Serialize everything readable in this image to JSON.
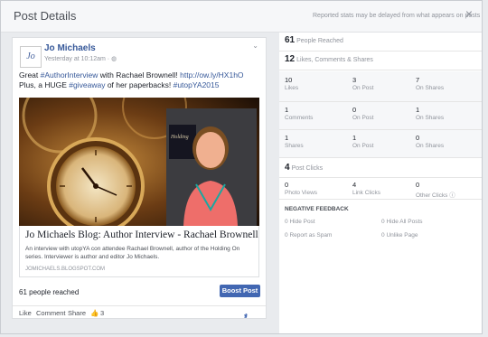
{
  "dialog": {
    "title": "Post Details",
    "notice": "Reported stats may be delayed from what appears on posts",
    "close": "×"
  },
  "post": {
    "avatar": "Jo",
    "author": "Jo Michaels",
    "time": "Yesterday at 10:12am · ",
    "text_a": "Great ",
    "tag1": "#AuthorInterview",
    "text_b": " with Rachael Brownell! ",
    "link": "http://ow.ly/HX1hO",
    "text_c": " Plus, a HUGE ",
    "tag2": "#giveaway",
    "text_d": " of her paperbacks! ",
    "tag3": "#utopYA2015",
    "link_title": "Jo Michaels Blog: Author Interview - Rachael Brownell",
    "link_desc": "An interview with utopYA con attendee Rachael Brownell, author of the Holding On series. Interviewer is author and editor Jo Michaels.",
    "link_domain": "JOMICHAELS.BLOGSPOT.COM",
    "reached": "61 people reached",
    "boost": "Boost Post",
    "like": "Like",
    "comment": "Comment",
    "share": "Share",
    "likes_count": "3",
    "poster_icon": "J"
  },
  "stats": {
    "reached_num": "61",
    "reached_label": "People Reached",
    "lcs_num": "12",
    "lcs_label": "Likes, Comments & Shares",
    "rows": [
      {
        "total": "10",
        "total_label": "Likes",
        "on_post": "3",
        "on_post_label": "On Post",
        "on_shares": "7",
        "on_shares_label": "On Shares"
      },
      {
        "total": "1",
        "total_label": "Comments",
        "on_post": "0",
        "on_post_label": "On Post",
        "on_shares": "1",
        "on_shares_label": "On Shares"
      },
      {
        "total": "1",
        "total_label": "Shares",
        "on_post": "1",
        "on_post_label": "On Post",
        "on_shares": "0",
        "on_shares_label": "On Shares"
      }
    ],
    "clicks_num": "4",
    "clicks_label": "Post Clicks",
    "photo_views": "0",
    "photo_views_label": "Photo Views",
    "link_clicks": "4",
    "link_clicks_label": "Link Clicks",
    "other_clicks": "0",
    "other_clicks_label": "Other Clicks",
    "neg_title": "NEGATIVE FEEDBACK",
    "hide_post": "0",
    "hide_post_label": "Hide Post",
    "hide_all": "0",
    "hide_all_label": "Hide All Posts",
    "spam": "0",
    "spam_label": "Report as Spam",
    "unlike": "0",
    "unlike_label": "Unlike Page"
  }
}
